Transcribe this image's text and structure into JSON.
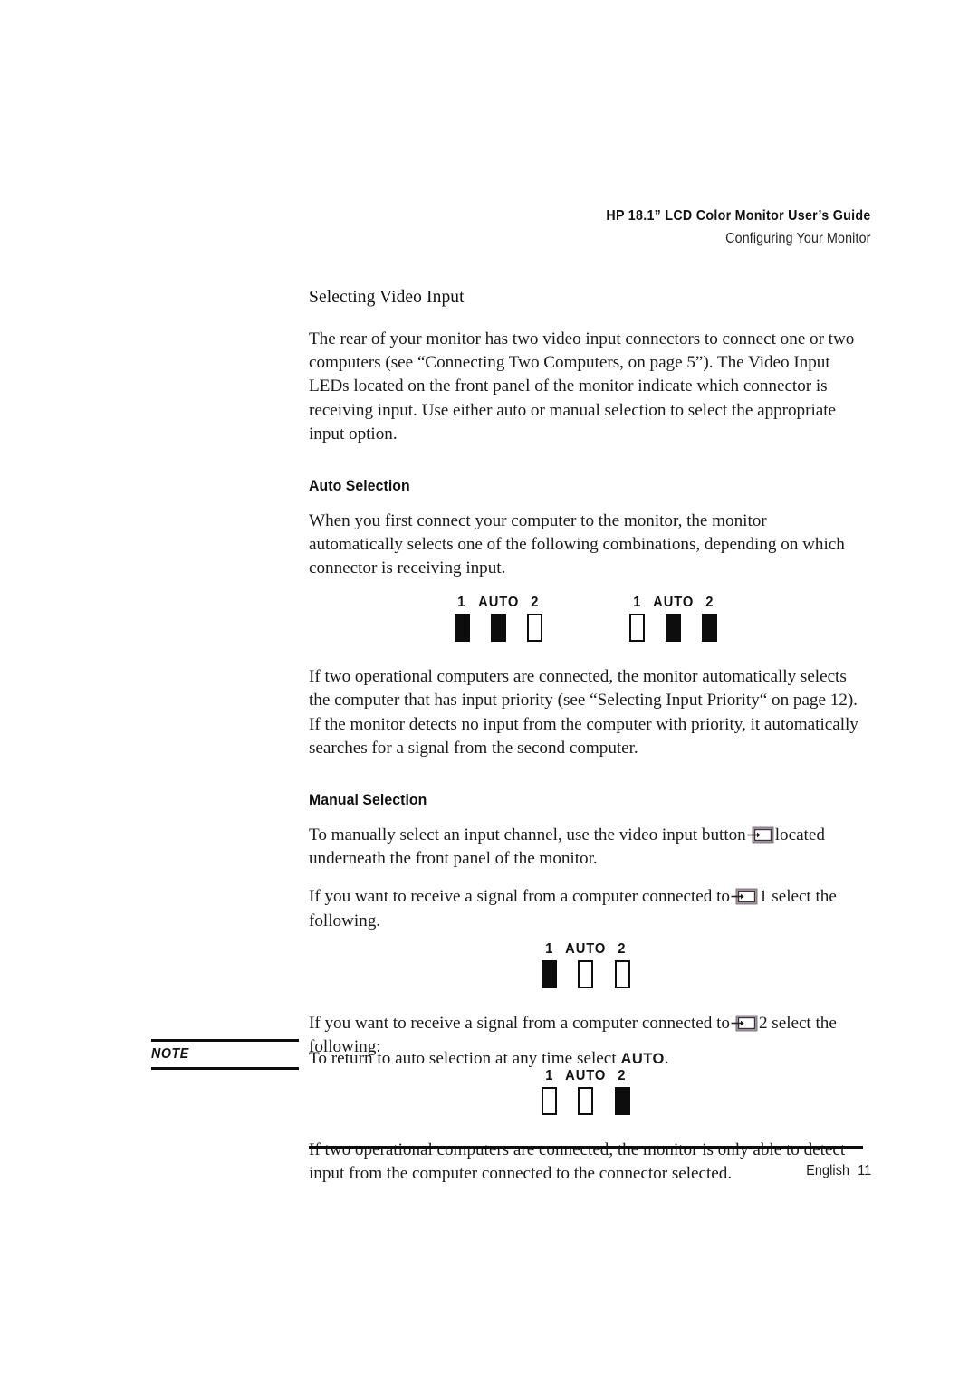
{
  "header": {
    "line1": "HP 18.1” LCD Color Monitor User’s Guide",
    "line2": "Configuring Your Monitor"
  },
  "section": {
    "title": "Selecting Video Input",
    "intro": "The rear of your monitor has two video input connectors to connect one or two computers (see “Connecting Two Computers, on page 5”). The Video Input LEDs located on the front panel of the monitor indicate which connector is receiving input. Use either auto or manual selection to select the appropriate input option."
  },
  "auto_selection": {
    "heading": "Auto Selection",
    "para1": "When you first connect your computer to the monitor, the monitor automatically selects one of the following combinations, depending on which connector is receiving input.",
    "para2": "If two operational computers are connected, the monitor automatically selects the computer that has input priority (see “Selecting Input Priority“ on page 12). If the monitor detects no input from the computer with priority, it automatically searches for a signal from the second computer."
  },
  "manual_selection": {
    "heading": "Manual Selection",
    "para1_before": "To manually select an input channel, use the video input button",
    "para1_after": "located underneath the front panel of the monitor.",
    "para2_before": "If you want to receive a signal from a computer connected to",
    "para2_connector": "1",
    "para2_after": "select the following.",
    "para3_before": "If you want to receive a signal from a computer connected to",
    "para3_connector": "2",
    "para3_after": "select the following:",
    "para4": "If two operational computers are connected, the monitor is only able to detect input from the computer connected to the connector selected."
  },
  "led_labels": {
    "one": "1",
    "auto": "AUTO",
    "two": "2"
  },
  "led_diagrams": [
    {
      "id": "auto-combination-a",
      "states": {
        "one": "on",
        "auto": "on",
        "two": "off"
      }
    },
    {
      "id": "auto-combination-b",
      "states": {
        "one": "off",
        "auto": "on",
        "two": "on"
      }
    },
    {
      "id": "manual-connector-1",
      "states": {
        "one": "on",
        "auto": "off",
        "two": "off"
      }
    },
    {
      "id": "manual-connector-2",
      "states": {
        "one": "off",
        "auto": "off",
        "two": "on"
      }
    }
  ],
  "icons": {
    "video_input": "video-input-connector-icon"
  },
  "note": {
    "label": "NOTE",
    "text_before": "To return to auto selection at any time select",
    "text_keyword": "AUTO",
    "text_after": "."
  },
  "footer": {
    "language": "English",
    "page_number": "11"
  },
  "colors": {
    "ink": "#0d0d0d",
    "body_text": "#1b1b1b",
    "paper": "#ffffff",
    "icon_outline": "#6b5f66"
  }
}
